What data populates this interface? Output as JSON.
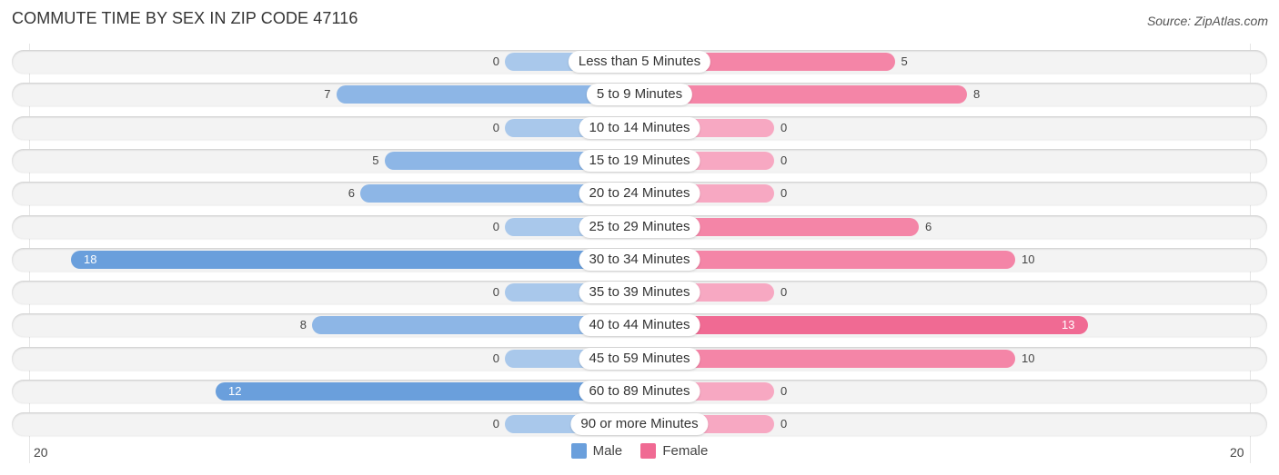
{
  "title": "COMMUTE TIME BY SEX IN ZIP CODE 47116",
  "source": "Source: ZipAtlas.com",
  "colors": {
    "male": "#6a9fdc",
    "male_light": "#a9c8eb",
    "female": "#f06a93",
    "female_light": "#f7a8c2",
    "row_bg": "#f3f3f3"
  },
  "chart_data": {
    "type": "bar",
    "orientation": "horizontal-diverging",
    "title": "COMMUTE TIME BY SEX IN ZIP CODE 47116",
    "categories": [
      "Less than 5 Minutes",
      "5 to 9 Minutes",
      "10 to 14 Minutes",
      "15 to 19 Minutes",
      "20 to 24 Minutes",
      "25 to 29 Minutes",
      "30 to 34 Minutes",
      "35 to 39 Minutes",
      "40 to 44 Minutes",
      "45 to 59 Minutes",
      "60 to 89 Minutes",
      "90 or more Minutes"
    ],
    "series": [
      {
        "name": "Male",
        "values": [
          0,
          7,
          0,
          5,
          6,
          0,
          18,
          0,
          8,
          0,
          12,
          0
        ]
      },
      {
        "name": "Female",
        "values": [
          5,
          8,
          0,
          0,
          0,
          6,
          10,
          0,
          13,
          10,
          0,
          0
        ]
      }
    ],
    "axis": {
      "left_label": "20",
      "right_label": "20",
      "max": 20
    },
    "legend": {
      "position": "bottom-center",
      "entries": [
        "Male",
        "Female"
      ]
    }
  }
}
